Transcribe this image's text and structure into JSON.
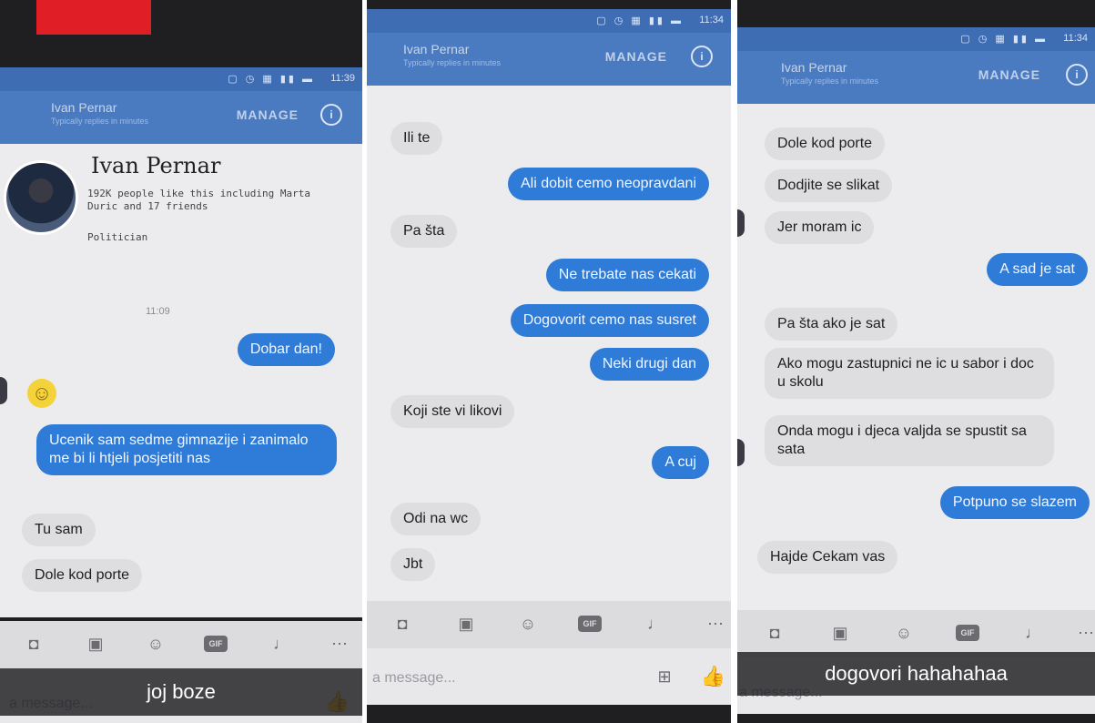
{
  "header": {
    "contact_name": "Ivan Pernar",
    "contact_status": "Typically replies in minutes",
    "manage_label": "MANAGE",
    "info_icon": "info-icon"
  },
  "status_bar": {
    "icons": "▢ ◷ ▦ ▮▮ ▬",
    "time": "11:39",
    "time_2": "11:34",
    "time_3": "11:34"
  },
  "profile": {
    "name": "Ivan Pernar",
    "likes": "192K people like this including Marta Duric and 17 friends",
    "category": "Politician"
  },
  "panel1": {
    "timestamp": "11:09",
    "messages": [
      {
        "side": "out",
        "text": "Dobar dan!"
      },
      {
        "side": "in",
        "text": "🙂"
      },
      {
        "side": "out",
        "text": "Ucenik sam sedme gimnazije i zanimalo me bi li htjeli posjetiti nas"
      },
      {
        "side": "in",
        "text": "Tu sam"
      },
      {
        "side": "in",
        "text": "Dole kod porte"
      }
    ],
    "caption": "joj boze"
  },
  "panel2": {
    "messages": [
      {
        "side": "in",
        "text": "Ili te"
      },
      {
        "side": "out",
        "text": "Ali dobit cemo neopravdani"
      },
      {
        "side": "in",
        "text": "Pa šta"
      },
      {
        "side": "out",
        "text": "Ne trebate nas cekati"
      },
      {
        "side": "out",
        "text": "Dogovorit cemo nas susret"
      },
      {
        "side": "out",
        "text": "Neki drugi dan"
      },
      {
        "side": "in",
        "text": "Koji ste vi likovi"
      },
      {
        "side": "out",
        "text": "A cuj"
      },
      {
        "side": "in",
        "text": "Odi na wc"
      },
      {
        "side": "in",
        "text": "Jbt"
      }
    ]
  },
  "panel3": {
    "messages": [
      {
        "side": "in",
        "text": "Dole kod porte"
      },
      {
        "side": "in",
        "text": "Dodjite se slikat"
      },
      {
        "side": "in",
        "text": "Jer moram ic"
      },
      {
        "side": "out",
        "text": "A sad je sat"
      },
      {
        "side": "in",
        "text": "Pa šta ako je sat"
      },
      {
        "side": "in",
        "text": "Ako mogu zastupnici ne ic u sabor i doc u skolu"
      },
      {
        "side": "in",
        "text": "Onda mogu i djeca valjda se spustit sa sata"
      },
      {
        "side": "out",
        "text": "Potpuno se slazem"
      },
      {
        "side": "in",
        "text": "Hajde Cekam vas"
      }
    ],
    "caption": "dogovori hahahahaa"
  },
  "composer": {
    "placeholder": "a message...",
    "gif_label": "GIF",
    "tools": [
      "camera-icon",
      "image-icon",
      "emoji-icon",
      "gif-icon",
      "microphone-icon",
      "more-icon"
    ],
    "like_icon": "thumbs-up-icon",
    "qr_icon": "qr-code-icon"
  },
  "colors": {
    "accent": "#2f7bd8",
    "header": "#4a7ac0",
    "incoming_bubble": "#dedee1",
    "caption_bar": "#1e1e22",
    "red_tag": "#e01e26"
  }
}
